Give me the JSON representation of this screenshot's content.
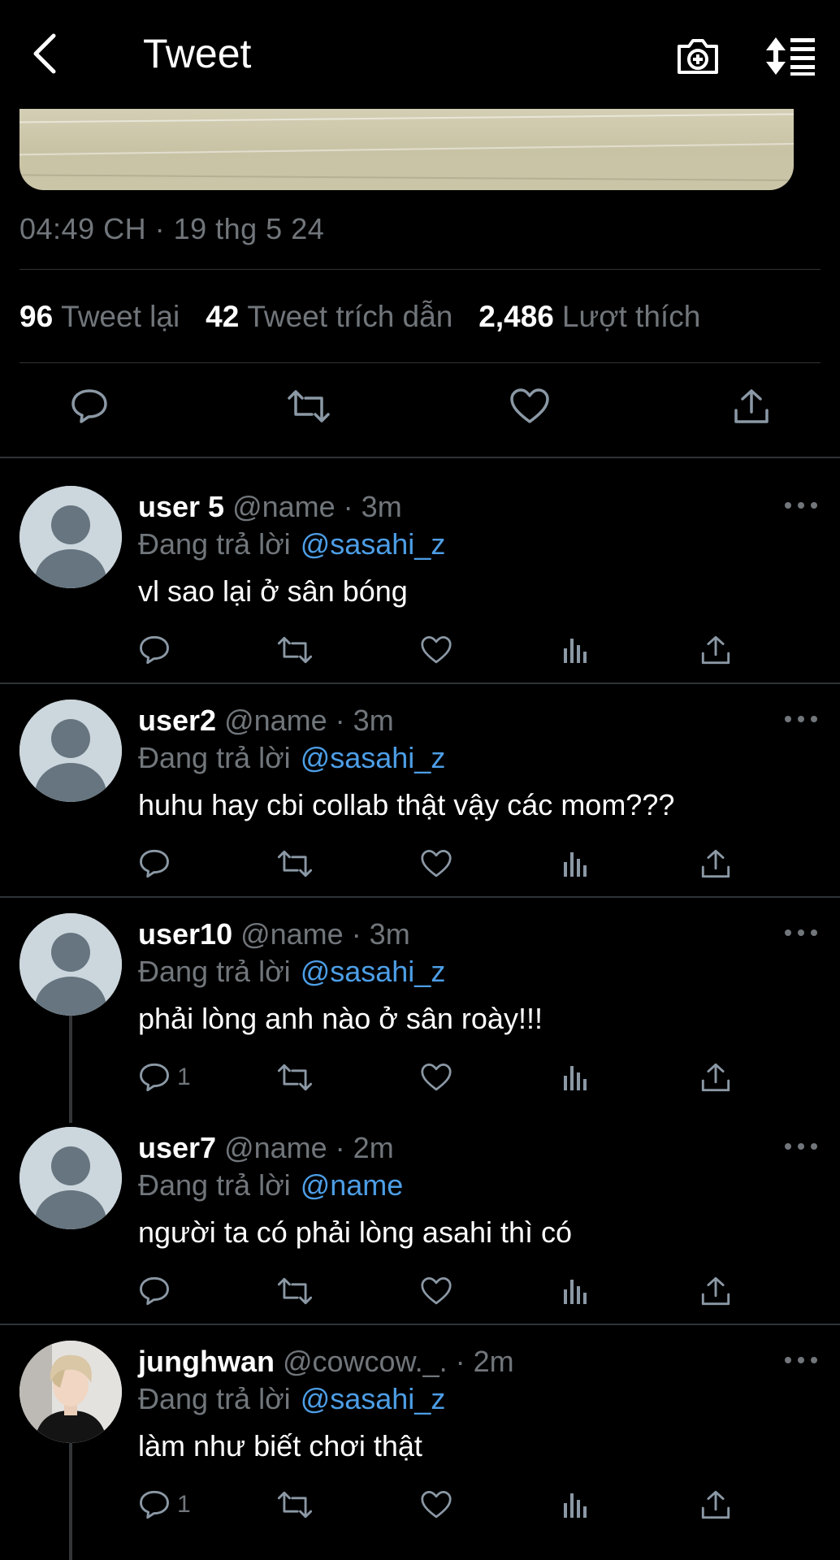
{
  "header": {
    "title": "Tweet",
    "back_icon": "chevron-left-icon",
    "camera_icon": "camera-plus-icon",
    "sort_icon": "sort-list-icon"
  },
  "tweet": {
    "timestamp": "04:49 CH · 19 thg 5 24",
    "stats": [
      {
        "count": "96",
        "label": "Tweet lại"
      },
      {
        "count": "42",
        "label": "Tweet trích dẫn"
      },
      {
        "count": "2,486",
        "label": "Lượt thích"
      }
    ]
  },
  "replies": [
    {
      "user": "user 5",
      "meta": "@name · 3m",
      "replying": "Đang trả lời",
      "mention": "@sasahi_z",
      "text": "vl sao lại ở sân bóng",
      "reply_count": ""
    },
    {
      "user": "user2",
      "meta": "@name · 3m",
      "replying": "Đang trả lời",
      "mention": "@sasahi_z",
      "text": "huhu hay cbi collab thật vậy các mom???",
      "reply_count": ""
    },
    {
      "user": "user10",
      "meta": "@name · 3m",
      "replying": "Đang trả lời",
      "mention": "@sasahi_z",
      "text": "phải lòng anh nào ở sân roày!!!",
      "reply_count": "1"
    },
    {
      "user": "user7",
      "meta": "@name · 2m",
      "replying": "Đang trả lời",
      "mention": "@name",
      "text": "người ta có phải lòng asahi thì có",
      "reply_count": ""
    },
    {
      "user": "junghwan",
      "meta": "@cowcow._. · 2m",
      "replying": "Đang trả lời",
      "mention": "@sasahi_z",
      "text": "làm như biết chơi thật",
      "reply_count": "1"
    }
  ],
  "colors": {
    "background": "#000000",
    "secondary_text": "#71767b",
    "mention": "#4d9ee6",
    "divider": "#2f3336",
    "avatar_placeholder": "#ccd6dd"
  }
}
